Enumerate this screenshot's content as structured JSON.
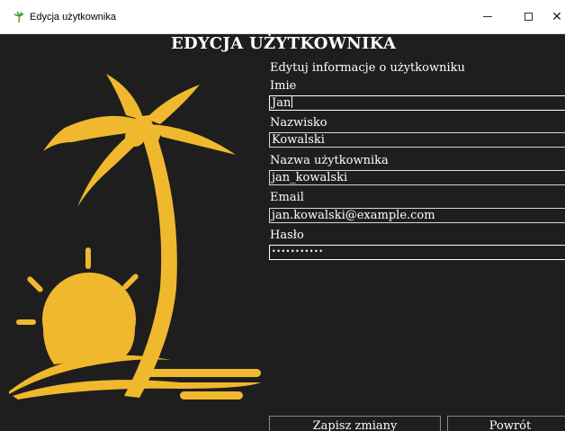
{
  "window": {
    "title": "Edycja użytkownika",
    "icon": "palm-tree-icon",
    "controls": {
      "minimize": "–",
      "maximize": "□",
      "close": "✕"
    }
  },
  "logo": {
    "icon": "palm-tree-sun-logo",
    "color": "#f0b82d"
  },
  "form": {
    "heading": "EDYCJA UŻYTKOWNIKA",
    "subheading": "Edytuj informacje o użytkowniku",
    "fields": [
      {
        "label": "Imie",
        "value": "Jan"
      },
      {
        "label": "Nazwisko",
        "value": "Kowalski"
      },
      {
        "label": "Nazwa użytkownika",
        "value": "jan_kowalski"
      },
      {
        "label": "Email",
        "value": "jan.kowalski@example.com"
      },
      {
        "label": "Hasło",
        "value": "•••••••••••"
      }
    ],
    "buttons": {
      "save": "Zapisz zmiany",
      "back": "Powrót"
    }
  },
  "colors": {
    "background": "#1e1e1e",
    "accent": "#f0b82d",
    "text": "#ffffff"
  }
}
